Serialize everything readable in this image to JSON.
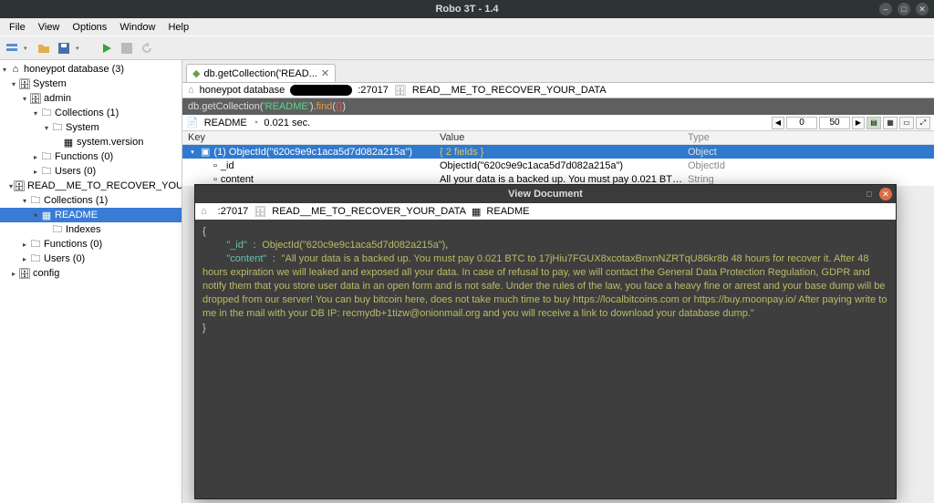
{
  "title": "Robo 3T - 1.4",
  "menubar": [
    "File",
    "View",
    "Options",
    "Window",
    "Help"
  ],
  "tree": [
    {
      "indent": 0,
      "exp": "▾",
      "icon": "server",
      "label": "honeypot database (3)"
    },
    {
      "indent": 1,
      "exp": "▾",
      "icon": "db",
      "label": "System"
    },
    {
      "indent": 2,
      "exp": "▾",
      "icon": "db",
      "label": "admin"
    },
    {
      "indent": 3,
      "exp": "▾",
      "icon": "folder",
      "label": "Collections (1)"
    },
    {
      "indent": 4,
      "exp": "▾",
      "icon": "folder",
      "label": "System"
    },
    {
      "indent": 5,
      "exp": " ",
      "icon": "coll",
      "label": "system.version"
    },
    {
      "indent": 3,
      "exp": "▸",
      "icon": "folder",
      "label": "Functions (0)"
    },
    {
      "indent": 3,
      "exp": "▸",
      "icon": "folder",
      "label": "Users (0)"
    },
    {
      "indent": 1,
      "exp": "▾",
      "icon": "db",
      "label": "READ__ME_TO_RECOVER_YOUR_DATA"
    },
    {
      "indent": 2,
      "exp": "▾",
      "icon": "folder",
      "label": "Collections (1)"
    },
    {
      "indent": 3,
      "exp": "▾",
      "icon": "coll",
      "label": "README",
      "selected": true
    },
    {
      "indent": 4,
      "exp": " ",
      "icon": "folder",
      "label": "Indexes"
    },
    {
      "indent": 2,
      "exp": "▸",
      "icon": "folder",
      "label": "Functions (0)"
    },
    {
      "indent": 2,
      "exp": "▸",
      "icon": "folder",
      "label": "Users (0)"
    },
    {
      "indent": 1,
      "exp": "▸",
      "icon": "db",
      "label": "config"
    }
  ],
  "tab": {
    "label": "db.getCollection('READ..."
  },
  "breadcrumb": {
    "db": "honeypot database",
    "port": ":27017",
    "coll": "READ__ME_TO_RECOVER_YOUR_DATA"
  },
  "query": {
    "pre": "db.getCollection(",
    "arg": "'README'",
    "mid": ").",
    "fn": "find",
    "open": "(",
    "obj": "{}",
    "close": ")"
  },
  "reshead": {
    "coll": "README",
    "time": "0.021 sec.",
    "pg_from": "0",
    "pg_size": "50"
  },
  "grid": {
    "headers": {
      "key": "Key",
      "value": "Value",
      "type": "Type"
    },
    "row_sel": {
      "key": "(1) ObjectId(\"620c9e9c1aca5d7d082a215a\")",
      "value": "{ 2 fields }",
      "type": "Object"
    },
    "row_id": {
      "key": "_id",
      "value": "ObjectId(\"620c9e9c1aca5d7d082a215a\")",
      "type": "ObjectId"
    },
    "row_ct": {
      "key": "content",
      "value": "All your data is a backed up. You must pay 0.021 BTC to 17jHiu7FGUX...",
      "type": "String"
    }
  },
  "viewdoc": {
    "title": "View Document",
    "crumb": {
      "port": ":27017",
      "db": "READ__ME_TO_RECOVER_YOUR_DATA",
      "coll": "README"
    },
    "json_id": "620c9e9c1aca5d7d082a215a",
    "json_content": "All your data is a backed up. You must pay 0.021 BTC to 17jHiu7FGUX8xcotaxBnxnNZRTqU86kr8b 48 hours for recover it. After 48 hours expiration we will leaked and exposed all your data. In case of refusal to pay, we will contact the General Data Protection Regulation, GDPR and notify them that you store user data in an open form and is not safe. Under the rules of the law, you face a heavy fine or arrest and your base dump will be dropped from our server! You can buy bitcoin here, does not take much time to buy https://localbitcoins.com or https://buy.moonpay.io/ After paying write to me in the mail with your DB IP: recmydb+1tizw@onionmail.org and you will receive a link to download your database dump."
  }
}
